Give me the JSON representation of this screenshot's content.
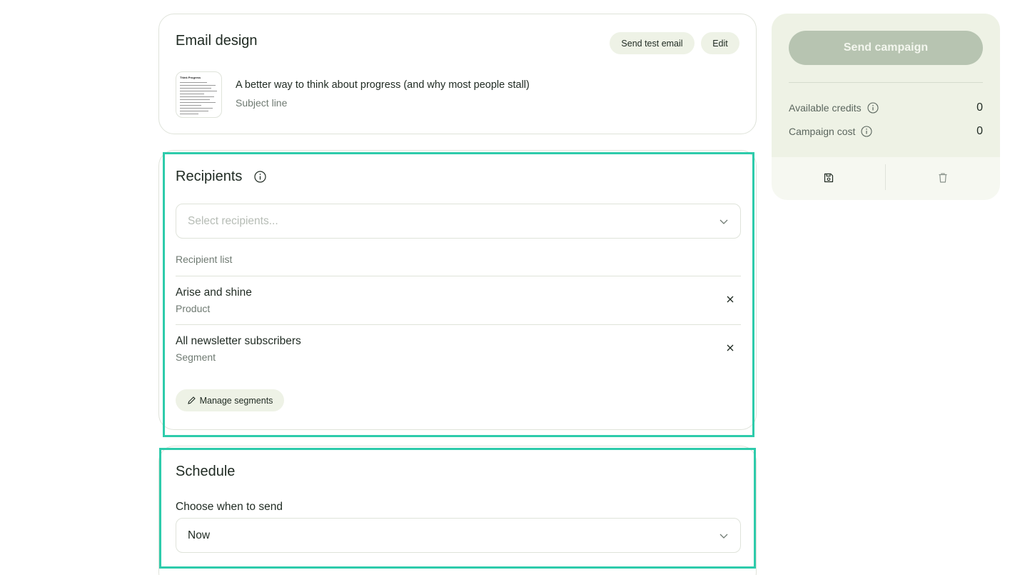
{
  "email_design": {
    "title": "Email design",
    "send_test_label": "Send test email",
    "edit_label": "Edit",
    "subject": "A better way to think about progress (and why most people stall)",
    "subject_label": "Subject line",
    "thumbnail_title": "Think Progress"
  },
  "recipients": {
    "title": "Recipients",
    "placeholder": "Select recipients...",
    "list_label": "Recipient list",
    "items": [
      {
        "name": "Arise and shine",
        "type": "Product"
      },
      {
        "name": "All newsletter subscribers",
        "type": "Segment"
      }
    ],
    "manage_label": "Manage segments"
  },
  "schedule": {
    "title": "Schedule",
    "choose_label": "Choose when to send",
    "selected": "Now"
  },
  "sidebar": {
    "send_label": "Send campaign",
    "credits_label": "Available credits",
    "credits_value": "0",
    "cost_label": "Campaign cost",
    "cost_value": "0"
  },
  "colors": {
    "accent_highlight": "#2ecbab",
    "pill_bg": "#eef2e6",
    "send_btn_disabled": "#b7c4b1",
    "sidebar_bg": "#eef2e5"
  }
}
